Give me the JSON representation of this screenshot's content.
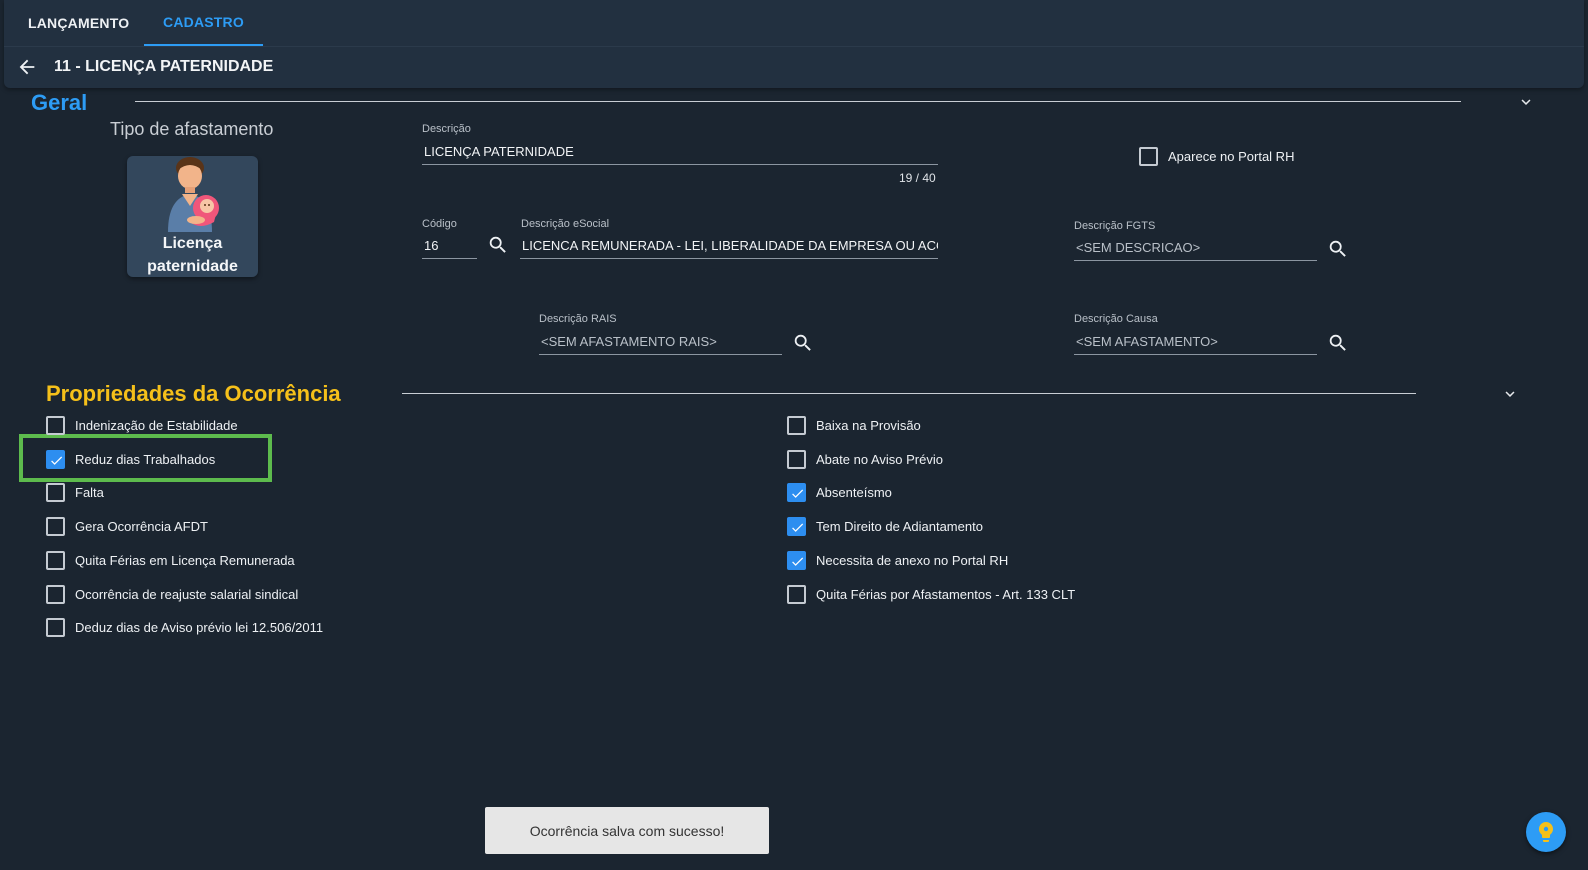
{
  "tabs": [
    {
      "label": "LANÇAMENTO",
      "active": false
    },
    {
      "label": "CADASTRO",
      "active": true
    }
  ],
  "header": {
    "title": "11 - LICENÇA PATERNIDADE"
  },
  "geral": {
    "section_title": "Geral",
    "tipo_afastamento_label": "Tipo de afastamento",
    "tipo_card_line1": "Licença",
    "tipo_card_line2": "paternidade",
    "descricao": {
      "label": "Descrição",
      "value": "LICENÇA PATERNIDADE",
      "counter": "19 / 40"
    },
    "aparece_portal": {
      "label": "Aparece no Portal RH",
      "checked": false
    },
    "codigo": {
      "label": "Código",
      "value": "16"
    },
    "descricao_esocial": {
      "label": "Descrição eSocial",
      "value": "LICENCA REMUNERADA - LEI, LIBERALIDADE DA EMPRESA OU ACORDO/"
    },
    "descricao_fgts": {
      "label": "Descrição FGTS",
      "value": "<SEM DESCRICAO>"
    },
    "descricao_rais": {
      "label": "Descrição RAIS",
      "value": "<SEM AFASTAMENTO RAIS>"
    },
    "descricao_causa": {
      "label": "Descrição Causa",
      "value": "<SEM AFASTAMENTO>"
    }
  },
  "propriedades": {
    "section_title": "Propriedades da Ocorrência",
    "left": [
      {
        "label": "Indenização de Estabilidade",
        "checked": false
      },
      {
        "label": "Reduz dias Trabalhados",
        "checked": true
      },
      {
        "label": "Falta",
        "checked": false
      },
      {
        "label": "Gera Ocorrência AFDT",
        "checked": false
      },
      {
        "label": "Quita Férias em Licença Remunerada",
        "checked": false
      },
      {
        "label": "Ocorrência de reajuste salarial sindical",
        "checked": false
      },
      {
        "label": "Deduz dias de Aviso prévio lei 12.506/2011",
        "checked": false
      }
    ],
    "right": [
      {
        "label": "Baixa na Provisão",
        "checked": false
      },
      {
        "label": "Abate no Aviso Prévio",
        "checked": false
      },
      {
        "label": "Absenteísmo",
        "checked": true
      },
      {
        "label": "Tem Direito de Adiantamento",
        "checked": true
      },
      {
        "label": "Necessita de anexo no Portal RH",
        "checked": true
      },
      {
        "label": "Quita Férias por Afastamentos - Art. 133 CLT",
        "checked": false
      }
    ]
  },
  "toast": {
    "message": "Ocorrência salva com sucesso!"
  },
  "icons": {
    "back": "arrow-left-icon",
    "search": "search-icon",
    "chevron": "chevron-down-icon",
    "fab": "lightbulb-icon"
  },
  "colors": {
    "background": "#1b2530",
    "accent_blue": "#2d9cf5",
    "section_yellow": "#f5c01a",
    "highlight_green": "#5dbb4d",
    "checkbox_checked": "#2d8ef0"
  }
}
